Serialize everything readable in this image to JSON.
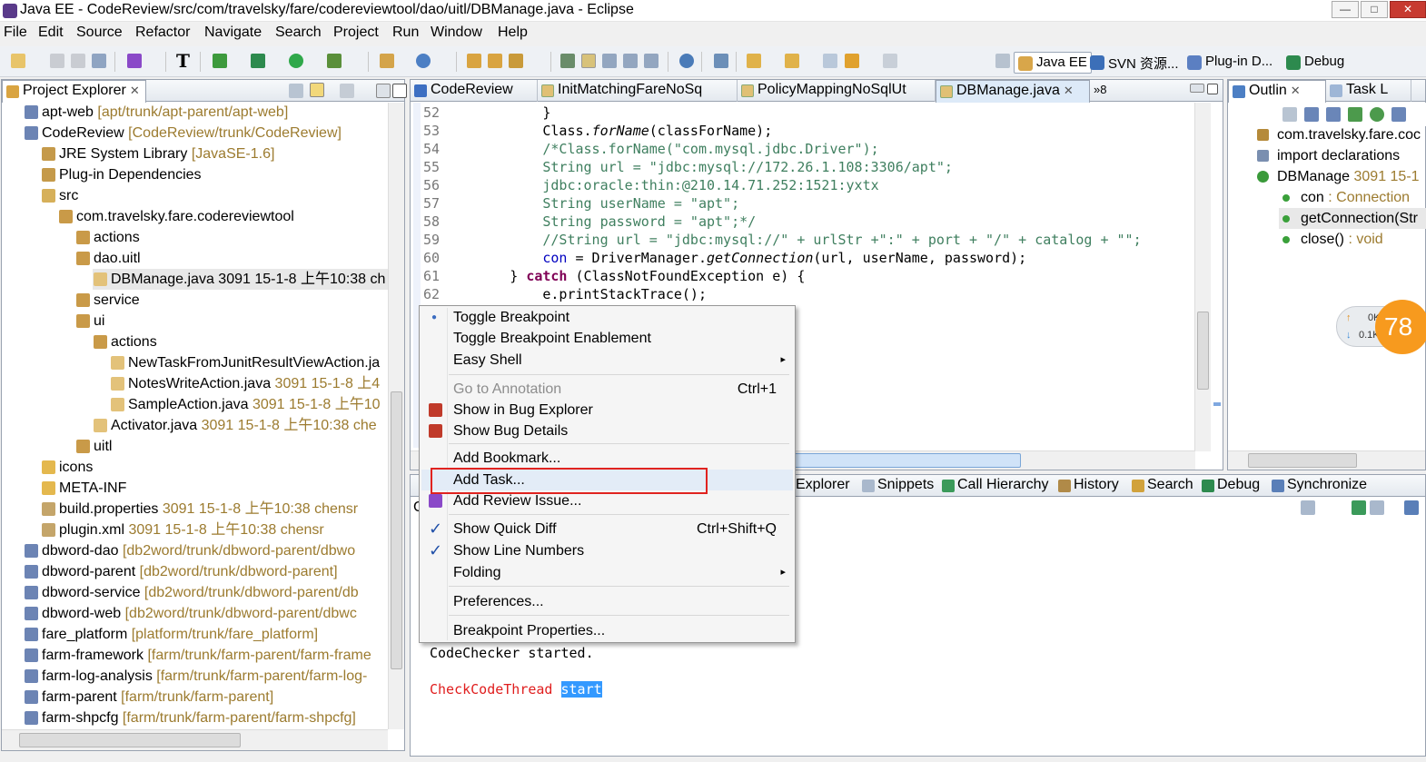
{
  "window": {
    "title": "Java EE - CodeReview/src/com/travelsky/fare/codereviewtool/dao/uitl/DBManage.java - Eclipse",
    "minimize": "—",
    "maximize": "□",
    "close": "✕"
  },
  "menu": [
    "File",
    "Edit",
    "Source",
    "Refactor",
    "Navigate",
    "Search",
    "Project",
    "Run",
    "Window",
    "Help"
  ],
  "toolbar_T": "T",
  "perspectives": [
    {
      "label": "Java EE"
    },
    {
      "label": "SVN 资源..."
    },
    {
      "label": "Plug-in D..."
    },
    {
      "label": "Debug"
    }
  ],
  "project_explorer": {
    "title": "Project Explorer",
    "close": "✕",
    "items": [
      {
        "label": "apt-web",
        "deco": " [apt/trunk/apt-parent/apt-web]",
        "indent": 0,
        "icon": "project-icon"
      },
      {
        "label": "CodeReview",
        "deco": " [CodeReview/trunk/CodeReview]",
        "indent": 0,
        "icon": "project-icon"
      },
      {
        "label": "JRE System Library",
        "deco": " [JavaSE-1.6]",
        "indent": 1,
        "icon": "library-icon"
      },
      {
        "label": "Plug-in Dependencies",
        "deco": "",
        "indent": 1,
        "icon": "library-icon"
      },
      {
        "label": "src",
        "deco": "",
        "indent": 1,
        "icon": "source-folder-icon"
      },
      {
        "label": "com.travelsky.fare.codereviewtool",
        "deco": "",
        "indent": 2,
        "icon": "package-icon"
      },
      {
        "label": "actions",
        "deco": "",
        "indent": 3,
        "icon": "package-icon"
      },
      {
        "label": "dao.uitl",
        "deco": "",
        "indent": 3,
        "icon": "package-icon"
      },
      {
        "label": "DBManage.java 3091  15-1-8 上午10:38  ch",
        "deco": "",
        "indent": 4,
        "icon": "java-file-icon",
        "selected": true
      },
      {
        "label": "service",
        "deco": "",
        "indent": 3,
        "icon": "package-icon"
      },
      {
        "label": "ui",
        "deco": "",
        "indent": 3,
        "icon": "package-icon"
      },
      {
        "label": "actions",
        "deco": "",
        "indent": 4,
        "icon": "package-icon"
      },
      {
        "label": "NewTaskFromJunitResultViewAction.ja",
        "deco": "",
        "indent": 5,
        "icon": "java-file-icon"
      },
      {
        "label": "NotesWriteAction.java",
        "deco": " 3091  15-1-8 上4",
        "indent": 5,
        "icon": "java-file-icon"
      },
      {
        "label": "SampleAction.java",
        "deco": " 3091  15-1-8 上午10",
        "indent": 5,
        "icon": "java-file-icon"
      },
      {
        "label": "Activator.java",
        "deco": " 3091  15-1-8 上午10:38  che",
        "indent": 4,
        "icon": "java-file-icon"
      },
      {
        "label": "uitl",
        "deco": "",
        "indent": 3,
        "icon": "package-icon"
      },
      {
        "label": "icons",
        "deco": "",
        "indent": 1,
        "icon": "folder-icon"
      },
      {
        "label": "META-INF",
        "deco": "",
        "indent": 1,
        "icon": "folder-icon"
      },
      {
        "label": "build.properties",
        "deco": " 3091  15-1-8 上午10:38  chensr",
        "indent": 1,
        "icon": "file-icon"
      },
      {
        "label": "plugin.xml",
        "deco": " 3091  15-1-8 上午10:38  chensr",
        "indent": 1,
        "icon": "file-icon"
      },
      {
        "label": "dbword-dao",
        "deco": " [db2word/trunk/dbword-parent/dbwo",
        "indent": 0,
        "icon": "project-icon"
      },
      {
        "label": "dbword-parent",
        "deco": " [db2word/trunk/dbword-parent]",
        "indent": 0,
        "icon": "project-icon"
      },
      {
        "label": "dbword-service",
        "deco": " [db2word/trunk/dbword-parent/db",
        "indent": 0,
        "icon": "project-icon"
      },
      {
        "label": "dbword-web",
        "deco": " [db2word/trunk/dbword-parent/dbwc",
        "indent": 0,
        "icon": "project-icon"
      },
      {
        "label": "fare_platform",
        "deco": " [platform/trunk/fare_platform]",
        "indent": 0,
        "icon": "project-icon"
      },
      {
        "label": "farm-framework",
        "deco": " [farm/trunk/farm-parent/farm-frame",
        "indent": 0,
        "icon": "project-icon"
      },
      {
        "label": "farm-log-analysis",
        "deco": " [farm/trunk/farm-parent/farm-log-",
        "indent": 0,
        "icon": "project-icon"
      },
      {
        "label": "farm-parent",
        "deco": " [farm/trunk/farm-parent]",
        "indent": 0,
        "icon": "project-icon"
      },
      {
        "label": "farm-shpcfg",
        "deco": " [farm/trunk/farm-parent/farm-shpcfg]",
        "indent": 0,
        "icon": "project-icon"
      }
    ]
  },
  "editor": {
    "tabs": [
      {
        "label": "CodeReview",
        "active": false
      },
      {
        "label": "InitMatchingFareNoSq",
        "active": false
      },
      {
        "label": "PolicyMappingNoSqlUt",
        "active": false
      },
      {
        "label": "DBManage.java",
        "active": true
      }
    ],
    "overflow": "»8",
    "lines": [
      {
        "n": "52",
        "t": "            }"
      },
      {
        "n": "53",
        "t": "            Class.forName(classForName);"
      },
      {
        "n": "54",
        "t": "            /*Class.forName(\"com.mysql.jdbc.Driver\");"
      },
      {
        "n": "55",
        "t": "            String url = \"jdbc:mysql://172.26.1.108:3306/apt\";"
      },
      {
        "n": "56",
        "t": "            jdbc:oracle:thin:@210.14.71.252:1521:yxtx"
      },
      {
        "n": "57",
        "t": "            String userName = \"apt\";"
      },
      {
        "n": "58",
        "t": "            String password = \"apt\";*/"
      },
      {
        "n": "59",
        "t": "            //String url = \"jdbc:mysql://\" + urlStr +\":\" + port + \"/\" + catalog + \"\";"
      },
      {
        "n": "60",
        "t": "            con = DriverManager.getConnection(url, userName, password);"
      },
      {
        "n": "61",
        "t": "        } catch (ClassNotFoundException e) {"
      },
      {
        "n": "62",
        "t": "            e.printStackTrace();"
      }
    ]
  },
  "context_menu": {
    "items": [
      {
        "label": "Toggle Breakpoint",
        "shortcut": "",
        "disabled": false
      },
      {
        "label": "Toggle Breakpoint Enablement",
        "shortcut": "",
        "disabled": false
      },
      {
        "label": "Easy Shell",
        "shortcut": "",
        "disabled": false,
        "submenu": true
      },
      {
        "label": "Go to Annotation",
        "shortcut": "Ctrl+1",
        "disabled": true
      },
      {
        "label": "Show in Bug Explorer",
        "shortcut": "",
        "disabled": false
      },
      {
        "label": "Show Bug Details",
        "shortcut": "",
        "disabled": false
      },
      {
        "label": "Add Bookmark...",
        "shortcut": "",
        "disabled": false
      },
      {
        "label": "Add Task...",
        "shortcut": "",
        "disabled": false,
        "highlighted": true
      },
      {
        "label": "Add Review Issue...",
        "shortcut": "",
        "disabled": false
      },
      {
        "label": "Show Quick Diff",
        "shortcut": "Ctrl+Shift+Q",
        "disabled": false,
        "checked": true
      },
      {
        "label": "Show Line Numbers",
        "shortcut": "",
        "disabled": false,
        "checked": true
      },
      {
        "label": "Folding",
        "shortcut": "",
        "disabled": false,
        "submenu": true
      },
      {
        "label": "Preferences...",
        "shortcut": "",
        "disabled": false
      },
      {
        "label": "Breakpoint Properties...",
        "shortcut": "",
        "disabled": false
      }
    ],
    "arrow": "▸",
    "check": "✓",
    "dot": "●"
  },
  "bottom_panel": {
    "tabs": [
      "Explorer",
      "Snippets",
      "Call Hierarchy",
      "History",
      "Search",
      "Debug",
      "Synchronize"
    ],
    "console": {
      "line1": "CodeChecker started.",
      "line2_a": "CheckCodeThread ",
      "line2_b": "start"
    },
    "prefix": "C"
  },
  "outline": {
    "tabs": [
      {
        "label": "Outlin"
      },
      {
        "label": "Task L"
      }
    ],
    "close": "✕",
    "items": [
      {
        "label": "com.travelsky.fare.coc",
        "deco": ""
      },
      {
        "label": "import declarations",
        "deco": ""
      },
      {
        "label": "DBManage",
        "deco": " 3091  15-1"
      },
      {
        "label": "con",
        "deco": " : Connection"
      },
      {
        "label": "getConnection(Str",
        "deco": ""
      },
      {
        "label": "close()",
        "deco": " : void"
      }
    ]
  },
  "net_widget": {
    "up": "0K/s",
    "down": "0.1K/s",
    "percent": "78"
  },
  "colors": {
    "accent": "#3875d7",
    "highlight_box": "#e0231f",
    "console_red": "#e01e1e",
    "selection": "#3399ff"
  }
}
